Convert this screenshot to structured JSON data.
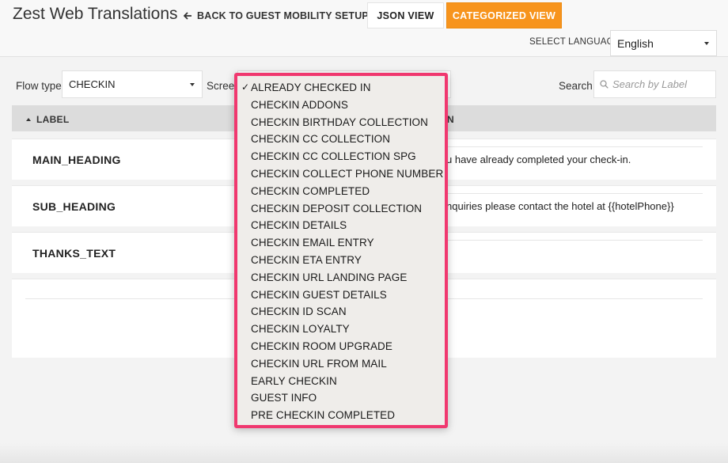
{
  "header": {
    "app_title": "Zest Web Translations",
    "back_link": "BACK TO GUEST MOBILITY SETUP",
    "json_view": "JSON VIEW",
    "categorized_view": "CATEGORIZED VIEW",
    "select_language_label": "SELECT LANGUAGE",
    "language_value": "English"
  },
  "filters": {
    "flow_type_label": "Flow type",
    "flow_type_value": "CHECKIN",
    "screen_label": "Screen",
    "search_label": "Search",
    "search_placeholder": "Search by Label"
  },
  "table": {
    "col_label": "LABEL",
    "col_right_fragment": "N",
    "rows": [
      {
        "key": "MAIN_HEADING",
        "value": "u have already completed your check-in."
      },
      {
        "key": "SUB_HEADING",
        "value": "nquiries please contact the hotel at {{hotelPhone}}"
      },
      {
        "key": "THANKS_TEXT",
        "value": ""
      }
    ]
  },
  "screen_dropdown": {
    "selected_check": "✓",
    "options": [
      "ALREADY CHECKED IN",
      "CHECKIN ADDONS",
      "CHECKIN BIRTHDAY COLLECTION",
      "CHECKIN CC COLLECTION",
      "CHECKIN CC COLLECTION SPG",
      "CHECKIN COLLECT PHONE NUMBER",
      "CHECKIN COMPLETED",
      "CHECKIN DEPOSIT COLLECTION",
      "CHECKIN DETAILS",
      "CHECKIN EMAIL ENTRY",
      "CHECKIN ETA ENTRY",
      "CHECKIN URL LANDING PAGE",
      "CHECKIN GUEST DETAILS",
      "CHECKIN ID SCAN",
      "CHECKIN LOYALTY",
      "CHECKIN ROOM UPGRADE",
      "CHECKIN URL FROM MAIL",
      "EARLY CHECKIN",
      "GUEST INFO",
      "PRE CHECKIN COMPLETED"
    ]
  },
  "colors": {
    "accent_orange": "#f7941d",
    "highlight_pink": "#f0386f"
  }
}
